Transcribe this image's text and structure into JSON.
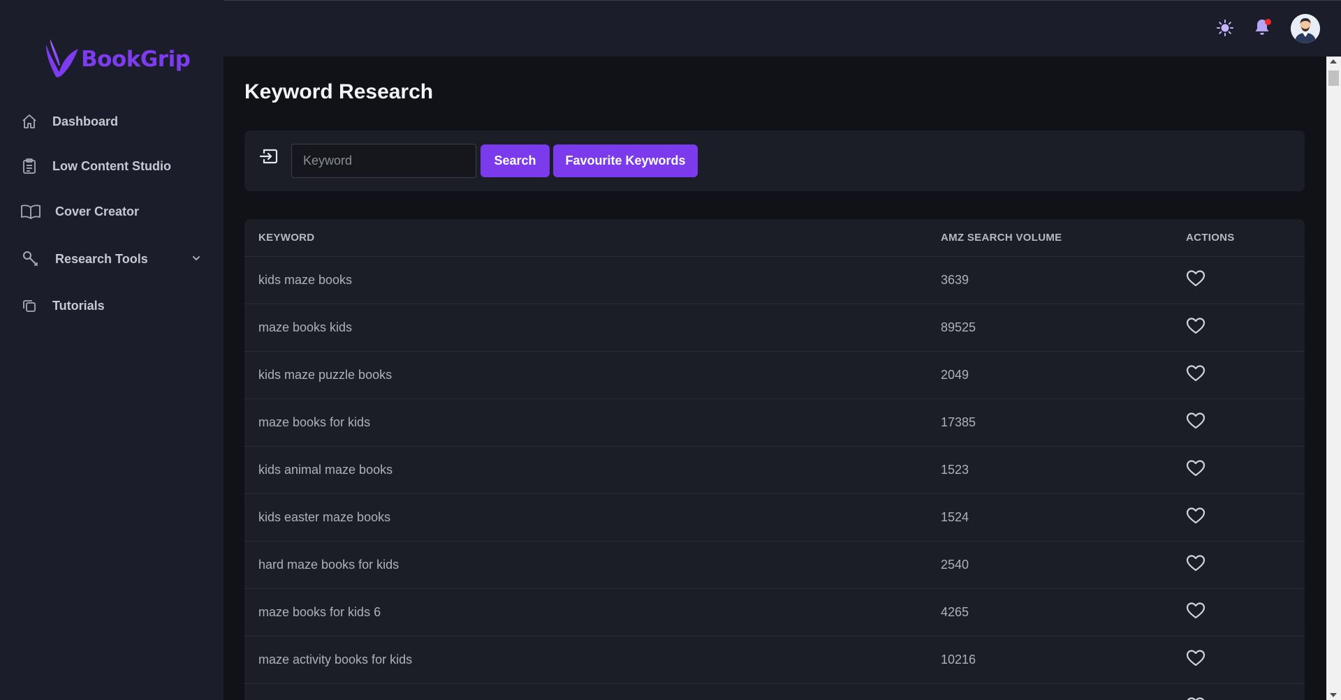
{
  "app": {
    "brand": "BookGrip",
    "accent_color": "#7c3aed",
    "notification_badge_color": "#ef2b2b"
  },
  "sidebar": {
    "items": [
      {
        "label": "Dashboard",
        "icon": "home-icon"
      },
      {
        "label": "Low Content Studio",
        "icon": "clipboard-icon"
      },
      {
        "label": "Cover Creator",
        "icon": "open-book-icon"
      },
      {
        "label": "Research Tools",
        "icon": "wrench-icon",
        "expandable": true
      },
      {
        "label": "Tutorials",
        "icon": "copy-icon"
      }
    ]
  },
  "topbar": {
    "icons": [
      "sun-icon",
      "bell-icon",
      "avatar"
    ]
  },
  "page": {
    "title": "Keyword Research"
  },
  "search": {
    "placeholder": "Keyword",
    "value": "",
    "search_label": "Search",
    "favourites_label": "Favourite Keywords"
  },
  "table": {
    "headers": {
      "keyword": "KEYWORD",
      "volume": "AMZ SEARCH VOLUME",
      "actions": "ACTIONS"
    },
    "rows": [
      {
        "keyword": "kids maze books",
        "volume": "3639"
      },
      {
        "keyword": "maze books kids",
        "volume": "89525"
      },
      {
        "keyword": "kids maze puzzle books",
        "volume": "2049"
      },
      {
        "keyword": "maze books for kids",
        "volume": "17385"
      },
      {
        "keyword": "kids animal maze books",
        "volume": "1523"
      },
      {
        "keyword": "kids easter maze books",
        "volume": "1524"
      },
      {
        "keyword": "hard maze books for kids",
        "volume": "2540"
      },
      {
        "keyword": "maze books for kids 6",
        "volume": "4265"
      },
      {
        "keyword": "maze activity books for kids",
        "volume": "10216"
      },
      {
        "keyword": "",
        "volume": ""
      }
    ]
  }
}
